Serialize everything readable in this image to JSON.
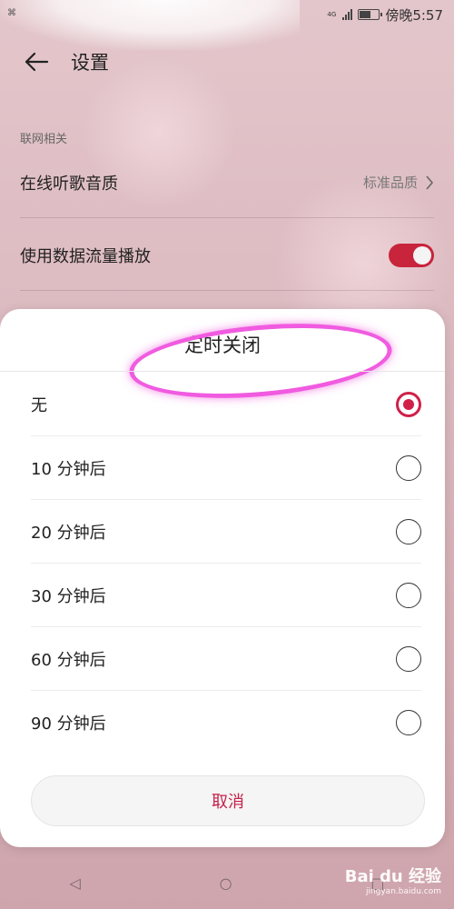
{
  "status": {
    "network": "4G",
    "time": "傍晚5:57"
  },
  "header": {
    "title": "设置"
  },
  "section": {
    "label": "联网相关"
  },
  "rows": [
    {
      "label": "在线听歌音质",
      "value": "标准品质"
    },
    {
      "label": "使用数据流量播放",
      "toggle": true
    }
  ],
  "dialog": {
    "title": "定时关闭",
    "options": [
      {
        "label": "无",
        "selected": true
      },
      {
        "label": "10 分钟后",
        "selected": false
      },
      {
        "label": "20 分钟后",
        "selected": false
      },
      {
        "label": "30 分钟后",
        "selected": false
      },
      {
        "label": "60 分钟后",
        "selected": false
      },
      {
        "label": "90 分钟后",
        "selected": false
      }
    ],
    "cancel_label": "取消"
  },
  "watermark": {
    "text": "Bai du 经验",
    "sub": "jingyan.baidu.com"
  },
  "colors": {
    "accent": "#d0204a",
    "annotation": "#f05be0"
  }
}
